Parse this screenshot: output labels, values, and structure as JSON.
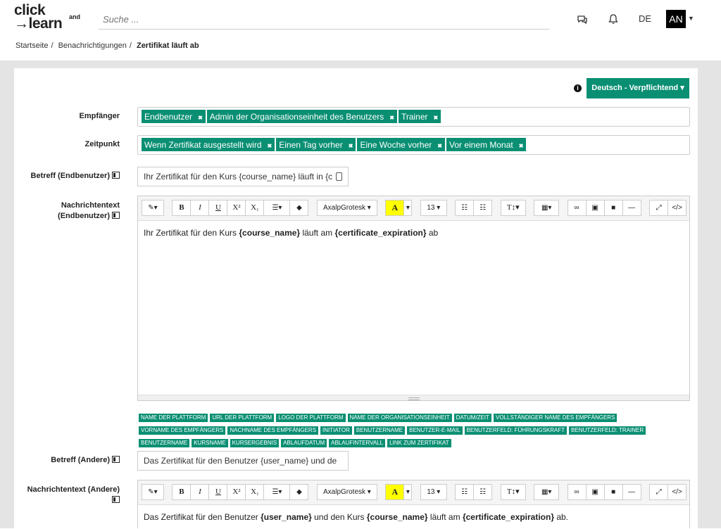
{
  "header": {
    "logo_line1": "click",
    "logo_and": "and",
    "logo_line2": "learn",
    "search_placeholder": "Suche ...",
    "language": "DE",
    "avatar_initials": "AN"
  },
  "breadcrumb": {
    "items": [
      "Startseite",
      "Benachrichtigungen"
    ],
    "current": "Zertifikat läuft ab"
  },
  "language_button": "Deutsch - Verpflichtend",
  "fields": {
    "recipients_label": "Empfänger",
    "recipients": [
      "Endbenutzer",
      "Admin der Organisationseinheit des Benutzers",
      "Trainer"
    ],
    "timing_label": "Zeitpunkt",
    "timing": [
      "Wenn Zertifikat ausgestellt wird",
      "Einen Tag vorher",
      "Eine Woche vorher",
      "Vor einem Monat"
    ],
    "subject_enduser_label": "Betreff (Endbenutzer)",
    "subject_enduser_value": "Ihr Zertifikat für den Kurs {course_name} läuft in {c",
    "message_enduser_label_1": "Nachrichtentext",
    "message_enduser_label_2": "(Endbenutzer)",
    "message_enduser": {
      "t1": "Ihr Zertifikat für den Kurs ",
      "b1": "{course_name}",
      "t2": " läuft am ",
      "b2": "{certificate_expiration}",
      "t3": " ab"
    },
    "subject_other_label": "Betreff (Andere)",
    "subject_other_value": "Das Zertifikat für den Benutzer {user_name} und de",
    "message_other_label": "Nachrichtentext (Andere)",
    "message_other": {
      "t1": "Das Zertifikat für den Benutzer ",
      "b1": "{user_name}",
      "t2": " und den Kurs ",
      "b2": "{course_name}",
      "t3": " läuft am ",
      "b3": "{certificate_expiration}",
      "t4": " ab."
    }
  },
  "toolbar": {
    "bold": "B",
    "italic": "I",
    "underline": "U",
    "superscript": "X²",
    "subscript": "X₁",
    "font": "AxalpGrotesk ▾",
    "color": "A",
    "size": "13 ▾",
    "textstyle": "T↕▾"
  },
  "placeholders": [
    "Name der Plattform",
    "URL der Plattform",
    "Logo der Plattform",
    "Name der Organisationseinheit",
    "Datum/Zeit",
    "Vollständiger Name des Empfängers",
    "Vorname des Empfängers",
    "Nachname des Empfängers",
    "Initiator",
    "Benutzername",
    "Benutzer-E-Mail",
    "Benutzerfeld: Führungskraft",
    "Benutzerfeld: Trainer",
    "Benutzername",
    "Kursname",
    "Kursergebnis",
    "Ablaufdatum",
    "Ablaufintervall",
    "Link zum Zertifikat"
  ],
  "colors": {
    "accent": "#0a8f73"
  },
  "icons": [
    "chat-icon",
    "bell-icon",
    "info-icon",
    "translate-icon",
    "magic-icon",
    "eraser-icon",
    "list-icon",
    "table-icon",
    "link-icon",
    "image-icon",
    "video-icon",
    "hr-icon",
    "fullscreen-icon",
    "code-icon",
    "paste-icon"
  ]
}
